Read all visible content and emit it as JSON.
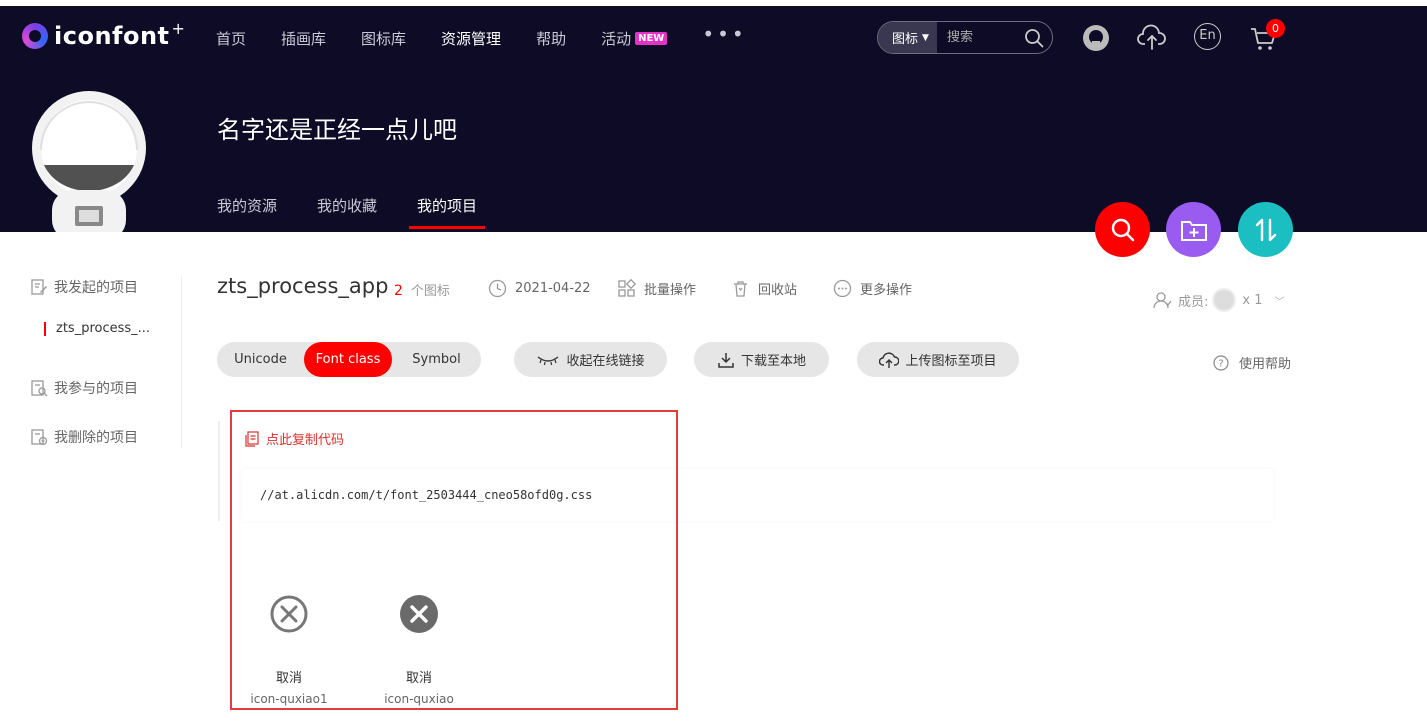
{
  "brand": {
    "name": "iconfont",
    "plus": "+"
  },
  "nav": {
    "items": [
      {
        "label": "首页"
      },
      {
        "label": "插画库"
      },
      {
        "label": "图标库"
      },
      {
        "label": "资源管理"
      },
      {
        "label": "帮助"
      },
      {
        "label": "活动"
      }
    ],
    "active_index": 3,
    "new_badge": "NEW",
    "more": "•••"
  },
  "search": {
    "type": "图标",
    "placeholder": "搜索"
  },
  "cart": {
    "count": "0"
  },
  "lang": "En",
  "user": {
    "name": "名字还是正经一点儿吧"
  },
  "subtabs": [
    {
      "label": "我的资源"
    },
    {
      "label": "我的收藏"
    },
    {
      "label": "我的项目"
    }
  ],
  "sidebar": {
    "created": "我发起的项目",
    "current_project": "zts_process_...",
    "joined": "我参与的项目",
    "deleted": "我删除的项目"
  },
  "project": {
    "name": "zts_process_app",
    "count": "2",
    "count_unit": "个图标",
    "date": "2021-04-22",
    "batch": "批量操作",
    "recycle": "回收站",
    "more": "更多操作",
    "members_label": "成员:",
    "members_count": "x 1"
  },
  "toolbar": {
    "modes": [
      "Unicode",
      "Font class",
      "Symbol"
    ],
    "active_mode": "Font class",
    "collapse_link": "收起在线链接",
    "download": "下载至本地",
    "upload": "上传图标至项目",
    "help": "使用帮助"
  },
  "code": {
    "copy_label": "点此复制代码",
    "url": "//at.alicdn.com/t/font_2503444_cneo58ofd0g.css"
  },
  "icons": [
    {
      "name": "取消",
      "code": "icon-quxiao1",
      "icon": "close-circle-outline-icon"
    },
    {
      "name": "取消",
      "code": "icon-quxiao",
      "icon": "close-circle-filled-icon"
    }
  ],
  "colors": {
    "banner": "#0e0b26",
    "accent": "#ff0000",
    "fab_search": "#ff0000",
    "fab_add": "#9a5cf0",
    "fab_sort": "#1bbfc2",
    "highlight": "#e63b3b"
  }
}
